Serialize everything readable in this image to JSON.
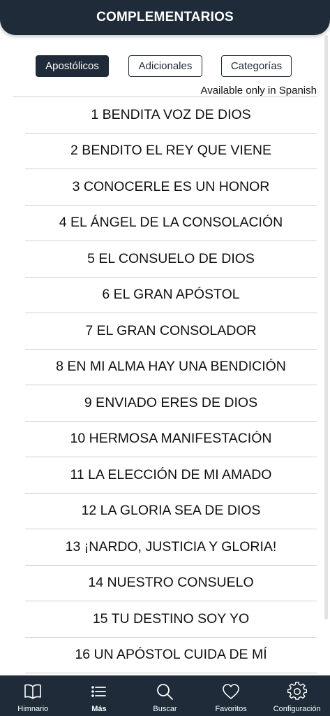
{
  "header": {
    "title": "COMPLEMENTARIOS"
  },
  "tabs": [
    {
      "label": "Apostólicos",
      "active": true
    },
    {
      "label": "Adicionales",
      "active": false
    },
    {
      "label": "Categorías",
      "active": false
    }
  ],
  "note": "Available only in Spanish",
  "hymns": [
    "1 BENDITA VOZ DE DIOS",
    "2 BENDITO EL REY QUE VIENE",
    "3 CONOCERLE ES UN HONOR",
    "4 EL ÁNGEL DE LA CONSOLACIÓN",
    "5 EL CONSUELO DE DIOS",
    "6 EL GRAN APÓSTOL",
    "7 EL GRAN CONSOLADOR",
    "8 EN MI ALMA HAY UNA BENDICIÓN",
    "9 ENVIADO ERES DE DIOS",
    "10 HERMOSA MANIFESTACIÓN",
    "11 LA ELECCIÓN DE MI AMADO",
    "12 LA GLORIA SEA DE DIOS",
    "13 ¡NARDO, JUSTICIA Y GLORIA!",
    "14 NUESTRO CONSUELO",
    "15 TU DESTINO SOY YO",
    "16 UN APÓSTOL CUIDA DE MÍ"
  ],
  "bottom_nav": [
    {
      "label": "Himnario",
      "icon": "book-icon",
      "active": false
    },
    {
      "label": "Más",
      "icon": "list-icon",
      "active": true
    },
    {
      "label": "Buscar",
      "icon": "search-icon",
      "active": false
    },
    {
      "label": "Favoritos",
      "icon": "heart-icon",
      "active": false
    },
    {
      "label": "Configuración",
      "icon": "gear-icon",
      "active": false
    }
  ],
  "colors": {
    "primary": "#1f2b38",
    "background": "#ffffff",
    "divider": "#d0d0d0"
  }
}
